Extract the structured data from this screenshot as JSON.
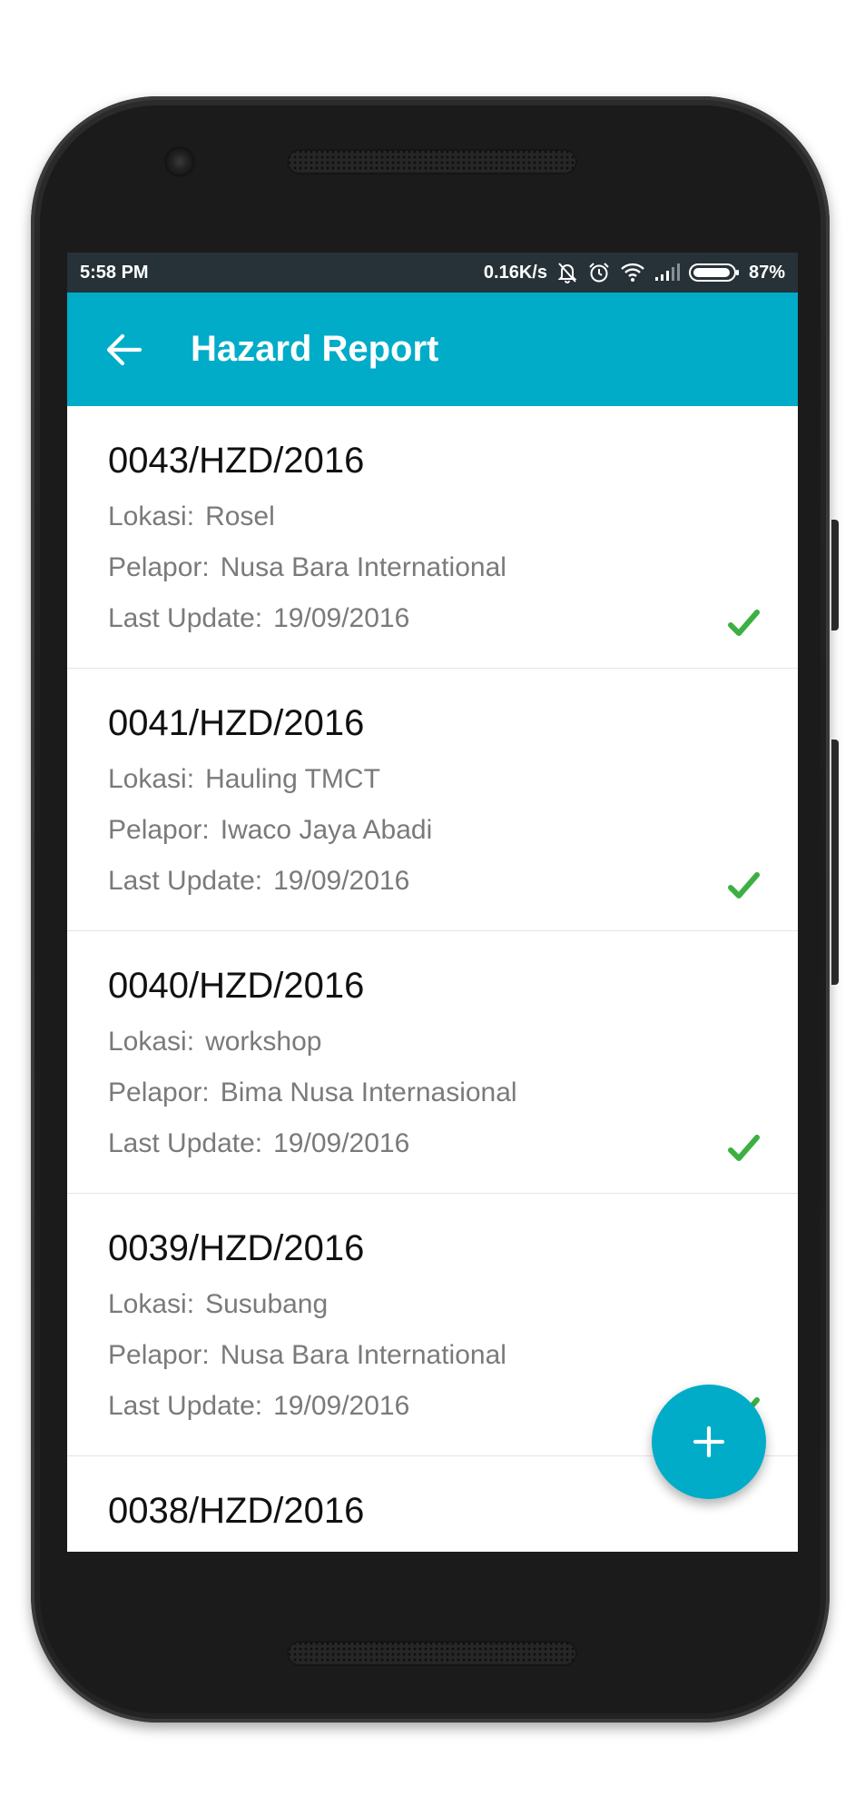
{
  "status_bar": {
    "time": "5:58 PM",
    "network_speed": "0.16K/s",
    "battery_percent": "87%",
    "icons": [
      "mute-bell-icon",
      "alarm-icon",
      "wifi-icon",
      "signal-icon",
      "battery-icon"
    ]
  },
  "app_bar": {
    "title": "Hazard Report",
    "back_icon": "arrow-left-icon"
  },
  "labels": {
    "location": "Lokasi:",
    "reporter": "Pelapor:",
    "last_update": "Last Update:"
  },
  "reports": [
    {
      "id": "0043/HZD/2016",
      "location": "Rosel",
      "reporter": "Nusa Bara International",
      "last_update": "19/09/2016",
      "status_icon": "check-icon"
    },
    {
      "id": "0041/HZD/2016",
      "location": "Hauling TMCT",
      "reporter": "Iwaco Jaya Abadi",
      "last_update": "19/09/2016",
      "status_icon": "check-icon"
    },
    {
      "id": "0040/HZD/2016",
      "location": "workshop",
      "reporter": "Bima Nusa Internasional",
      "last_update": "19/09/2016",
      "status_icon": "check-icon"
    },
    {
      "id": "0039/HZD/2016",
      "location": "Susubang",
      "reporter": "Nusa Bara International",
      "last_update": "19/09/2016",
      "status_icon": "check-icon"
    },
    {
      "id": "0038/HZD/2016"
    }
  ],
  "fab": {
    "icon": "plus-icon"
  },
  "colors": {
    "accent": "#00acc8",
    "status_bar": "#263238",
    "check": "#3cb043",
    "title_text": "#111111",
    "secondary_text": "#7a7a7a"
  }
}
